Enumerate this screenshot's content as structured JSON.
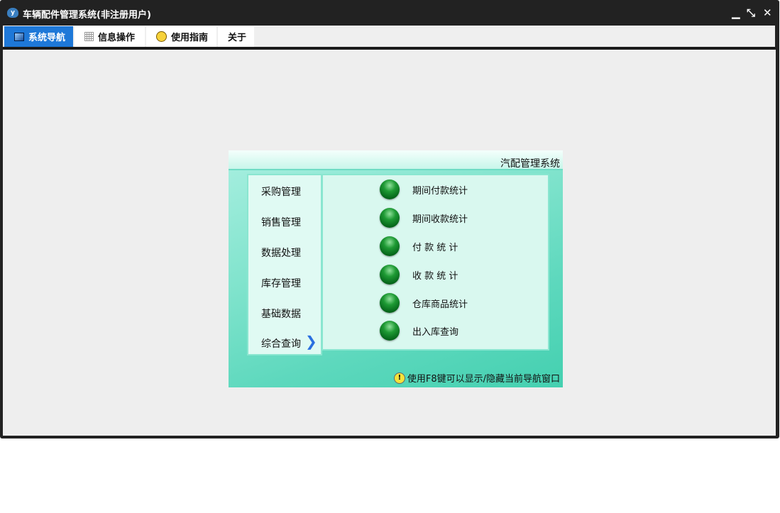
{
  "window": {
    "title": "车辆配件管理系统(非注册用户)",
    "minimize": "▁",
    "restore": "⤡",
    "close": "✕"
  },
  "tabs": [
    {
      "label": "系统导航",
      "icon": "monitor-icon",
      "active": true
    },
    {
      "label": "信息操作",
      "icon": "grid-icon"
    },
    {
      "label": "使用指南",
      "icon": "help-icon"
    },
    {
      "label": "关于"
    }
  ],
  "panel": {
    "title": "汽配管理系统",
    "menu": [
      "采购管理",
      "销售管理",
      "数据处理",
      "库存管理",
      "基础数据",
      "综合查询"
    ],
    "active_menu": "综合查询",
    "subitems": [
      "期间付款统计",
      "期间收款统计",
      "付 款 统 计",
      "收 款 统 计",
      "仓库商品统计",
      "出入库查询"
    ],
    "hint": "使用F8键可以显示/隐藏当前导航窗口"
  }
}
